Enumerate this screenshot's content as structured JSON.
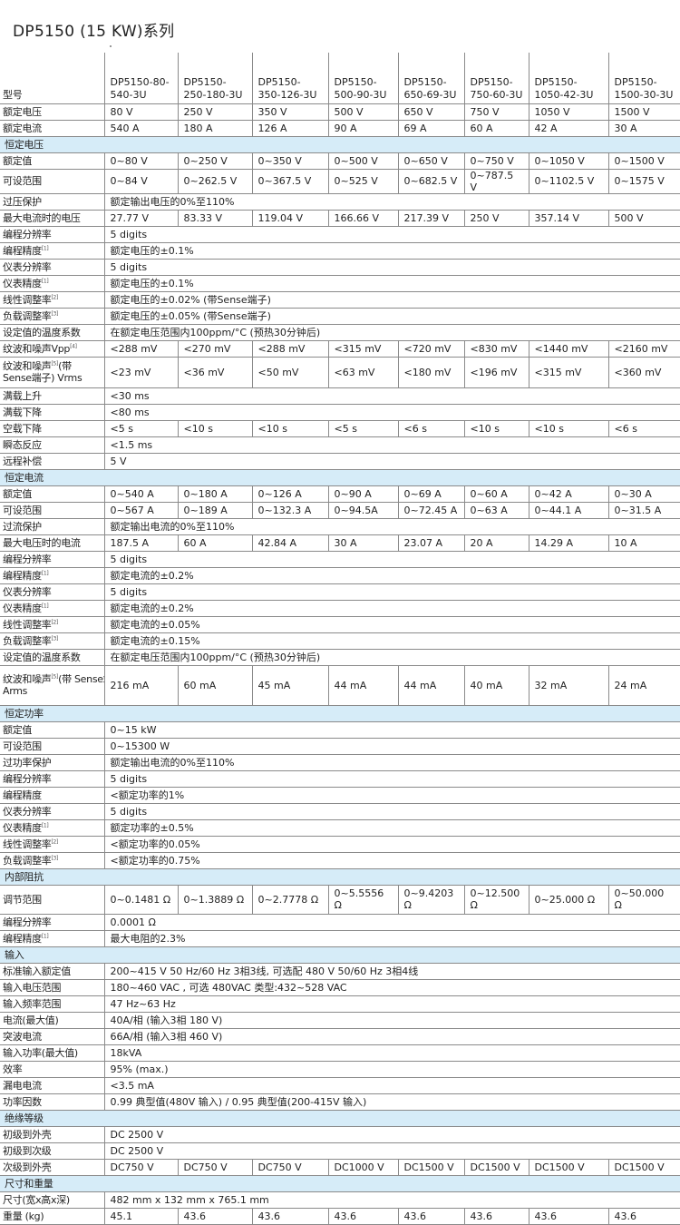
{
  "title": "DP5150 (15 KW)系列",
  "rows": [
    {
      "type": "header",
      "h": 56,
      "label": "型号",
      "values": [
        "DP5150-80-540-3U",
        "DP5150-250-180-3U",
        "DP5150-350-126-3U",
        "DP5150-500-90-3U",
        "DP5150-650-69-3U",
        "DP5150-750-60-3U",
        "DP5150-1050-42-3U",
        "DP5150-1500-30-3U"
      ]
    },
    {
      "type": "row",
      "h": 18,
      "label": "额定电压",
      "values": [
        "80 V",
        "250 V",
        "350 V",
        "500 V",
        "650 V",
        "750 V",
        "1050 V",
        "1500 V"
      ]
    },
    {
      "type": "row",
      "h": 18,
      "label": "额定电流",
      "values": [
        "540 A",
        "180 A",
        "126 A",
        "90 A",
        "69 A",
        "60 A",
        "42 A",
        "30 A"
      ]
    },
    {
      "type": "section",
      "h": 18,
      "label": "恒定电压"
    },
    {
      "type": "row",
      "h": 18,
      "label": "额定值",
      "values": [
        "0~80 V",
        "0~250 V",
        "0~350 V",
        "0~500 V",
        "0~650 V",
        "0~750 V",
        "0~1050 V",
        "0~1500 V"
      ]
    },
    {
      "type": "row",
      "h": 18,
      "label": "可设范围",
      "values": [
        "0~84 V",
        "0~262.5 V",
        "0~367.5 V",
        "0~525 V",
        "0~682.5 V",
        "0~787.5 V",
        "0~1102.5 V",
        "0~1575 V"
      ]
    },
    {
      "type": "row",
      "h": 18,
      "label": "过压保护",
      "value": "额定输出电压的0%至110%"
    },
    {
      "type": "row",
      "h": 18,
      "label": "最大电流时的电压",
      "values": [
        "27.77 V",
        "83.33 V",
        "119.04 V",
        "166.66 V",
        "217.39 V",
        "250 V",
        "357.14 V",
        "500 V"
      ]
    },
    {
      "type": "row",
      "h": 18,
      "label": "编程分辨率",
      "value": "5 digits"
    },
    {
      "type": "row",
      "h": 18,
      "label": "编程精度",
      "sup": "[1]",
      "value": "额定电压的±0.1%"
    },
    {
      "type": "row",
      "h": 18,
      "label": "仪表分辨率",
      "value": "5 digits"
    },
    {
      "type": "row",
      "h": 18,
      "label": "仪表精度",
      "sup": "[1]",
      "value": "额定电压的±0.1%"
    },
    {
      "type": "row",
      "h": 18,
      "label": "线性调整率",
      "sup": "[2]",
      "value": "额定电压的±0.02% (带Sense端子)"
    },
    {
      "type": "row",
      "h": 18,
      "label": "负载调整率",
      "sup": "[3]",
      "value": "额定电压的±0.05% (带Sense端子)"
    },
    {
      "type": "row",
      "h": 18,
      "label": "设定值的温度系数",
      "value": "在额定电压范围内100ppm/°C (预热30分钟后)"
    },
    {
      "type": "row",
      "h": 18,
      "label": "纹波和噪声Vpp",
      "sup": "[4]",
      "values": [
        "<288 mV",
        "<270 mV",
        "<288 mV",
        "<315 mV",
        "<720 mV",
        "<830 mV",
        "<1440 mV",
        "<2160 mV"
      ]
    },
    {
      "type": "row",
      "h": 34,
      "label": "纹波和噪声",
      "sup": "[5]",
      "label2": "(带",
      "label3": "Sense端子) Vrms",
      "values": [
        "<23 mV",
        "<36 mV",
        "<50 mV",
        "<63 mV",
        "<180 mV",
        "<196 mV",
        "<315 mV",
        "<360 mV"
      ]
    },
    {
      "type": "row",
      "h": 18,
      "label": "满载上升",
      "value": "<30 ms"
    },
    {
      "type": "row",
      "h": 18,
      "label": "满载下降",
      "value": "<80 ms"
    },
    {
      "type": "row",
      "h": 18,
      "label": "空载下降",
      "values": [
        "<5 s",
        "<10 s",
        "<10 s",
        "<5 s",
        "<6 s",
        "<10 s",
        "<10 s",
        "<6 s"
      ]
    },
    {
      "type": "row",
      "h": 18,
      "label": "瞬态反应",
      "value": "<1.5 ms"
    },
    {
      "type": "row",
      "h": 18,
      "label": "远程补偿",
      "value": "5 V"
    },
    {
      "type": "section",
      "h": 18,
      "label": "恒定电流"
    },
    {
      "type": "row",
      "h": 18,
      "label": "额定值",
      "values": [
        "0~540 A",
        "0~180 A",
        "0~126 A",
        "0~90 A",
        "0~69 A",
        "0~60 A",
        "0~42 A",
        "0~30 A"
      ]
    },
    {
      "type": "row",
      "h": 18,
      "label": "可设范围",
      "values": [
        "0~567 A",
        "0~189 A",
        "0~132.3 A",
        "0~94.5A",
        "0~72.45 A",
        "0~63 A",
        "0~44.1 A",
        "0~31.5 A"
      ]
    },
    {
      "type": "row",
      "h": 18,
      "label": "过流保护",
      "value": "额定输出电流的0%至110%"
    },
    {
      "type": "row",
      "h": 18,
      "label": "最大电压时的电流",
      "values": [
        "187.5 A",
        "60 A",
        "42.84 A",
        "30 A",
        "23.07 A",
        "20 A",
        "14.29 A",
        "10 A"
      ]
    },
    {
      "type": "row",
      "h": 18,
      "label": "编程分辨率",
      "value": "5 digits"
    },
    {
      "type": "row",
      "h": 18,
      "label": "编程精度",
      "sup": "[1]",
      "value": "额定电流的±0.2%"
    },
    {
      "type": "row",
      "h": 18,
      "label": "仪表分辨率",
      "value": "5 digits"
    },
    {
      "type": "row",
      "h": 18,
      "label": "仪表精度",
      "sup": "[1]",
      "value": "额定电流的±0.2%"
    },
    {
      "type": "row",
      "h": 18,
      "label": "线性调整率",
      "sup": "[2]",
      "value": "额定电流的±0.05%"
    },
    {
      "type": "row",
      "h": 18,
      "label": "负载调整率",
      "sup": "[3]",
      "value": "额定电流的±0.15%"
    },
    {
      "type": "row",
      "h": 18,
      "label": "设定值的温度系数",
      "value": "在额定电压范围内100ppm/°C (预热30分钟后)"
    },
    {
      "type": "row",
      "h": 44,
      "label": "纹波和噪声",
      "sup": "[5]",
      "label2": "(带 Sense端子)",
      "label3": "Arms",
      "values": [
        "216 mA",
        "60 mA",
        "45 mA",
        "44 mA",
        "44 mA",
        "40 mA",
        "32 mA",
        "24 mA"
      ]
    },
    {
      "type": "section",
      "h": 18,
      "label": "恒定功率"
    },
    {
      "type": "row",
      "h": 18,
      "label": "额定值",
      "value": "0~15 kW"
    },
    {
      "type": "row",
      "h": 18,
      "label": "可设范围",
      "value": "0~15300 W"
    },
    {
      "type": "row",
      "h": 18,
      "label": "过功率保护",
      "value": "额定输出电流的0%至110%"
    },
    {
      "type": "row",
      "h": 18,
      "label": "编程分辨率",
      "value": "5 digits"
    },
    {
      "type": "row",
      "h": 18,
      "label": "编程精度",
      "value": "<额定功率的1%"
    },
    {
      "type": "row",
      "h": 18,
      "label": "仪表分辨率",
      "value": "5 digits"
    },
    {
      "type": "row",
      "h": 18,
      "label": "仪表精度",
      "sup": "[1]",
      "value": "额定功率的±0.5%"
    },
    {
      "type": "row",
      "h": 18,
      "label": "线性调整率",
      "sup": "[2]",
      "value": "<额定功率的0.05%"
    },
    {
      "type": "row",
      "h": 18,
      "label": "负载调整率",
      "sup": "[3]",
      "value": "<额定功率的0.75%"
    },
    {
      "type": "section",
      "h": 18,
      "label": "内部阻抗"
    },
    {
      "type": "row",
      "h": 32,
      "label": "调节范围",
      "values": [
        "0~0.1481 Ω",
        "0~1.3889 Ω",
        "0~2.7778 Ω",
        "0~5.5556 Ω",
        "0~9.4203 Ω",
        "0~12.500 Ω",
        "0~25.000 Ω",
        "0~50.000 Ω"
      ]
    },
    {
      "type": "row",
      "h": 18,
      "label": "编程分辨率",
      "value": "0.0001 Ω"
    },
    {
      "type": "row",
      "h": 18,
      "label": "编程精度",
      "sup": "[1]",
      "value": "最大电阻的2.3%"
    },
    {
      "type": "section",
      "h": 18,
      "label": "输入"
    },
    {
      "type": "row",
      "h": 18,
      "label": "标准输入额定值",
      "value": "200~415 V 50 Hz/60 Hz 3相3线, 可选配 480 V 50/60 Hz 3相4线"
    },
    {
      "type": "row",
      "h": 18,
      "label": "输入电压范围",
      "value": "180~460 VAC , 可选 480VAC 类型:432~528 VAC"
    },
    {
      "type": "row",
      "h": 18,
      "label": "输入频率范围",
      "value": "47 Hz~63 Hz"
    },
    {
      "type": "row",
      "h": 18,
      "label": "电流(最大值)",
      "value": "40A/相 (输入3相 180 V)"
    },
    {
      "type": "row",
      "h": 18,
      "label": "突波电流",
      "value": "66A/相 (输入3相 460 V)"
    },
    {
      "type": "row",
      "h": 18,
      "label": "输入功率(最大值)",
      "value": "18kVA"
    },
    {
      "type": "row",
      "h": 18,
      "label": "效率",
      "value": "95% (max.)"
    },
    {
      "type": "row",
      "h": 18,
      "label": "漏电电流",
      "value": "<3.5 mA"
    },
    {
      "type": "row",
      "h": 18,
      "label": "功率因数",
      "value": "0.99 典型值(480V 输入) / 0.95 典型值(200-415V 输入)"
    },
    {
      "type": "section",
      "h": 18,
      "label": "绝缘等级"
    },
    {
      "type": "row",
      "h": 18,
      "label": "初级到外壳",
      "value": "DC 2500 V"
    },
    {
      "type": "row",
      "h": 18,
      "label": "初级到次级",
      "value": "DC 2500 V"
    },
    {
      "type": "row",
      "h": 18,
      "label": "次级到外壳",
      "values": [
        "DC750 V",
        "DC750 V",
        "DC750 V",
        "DC1000 V",
        "DC1500 V",
        "DC1500 V",
        "DC1500 V",
        "DC1500 V"
      ]
    },
    {
      "type": "section",
      "h": 18,
      "label": "尺寸和重量"
    },
    {
      "type": "row",
      "h": 18,
      "label": "尺寸(宽x高x深)",
      "value": "482 mm x 132 mm x 765.1 mm"
    },
    {
      "type": "row",
      "h": 18,
      "label": "重量 (kg)",
      "values": [
        "45.1",
        "43.6",
        "43.6",
        "43.6",
        "43.6",
        "43.6",
        "43.6",
        "43.6"
      ]
    }
  ]
}
